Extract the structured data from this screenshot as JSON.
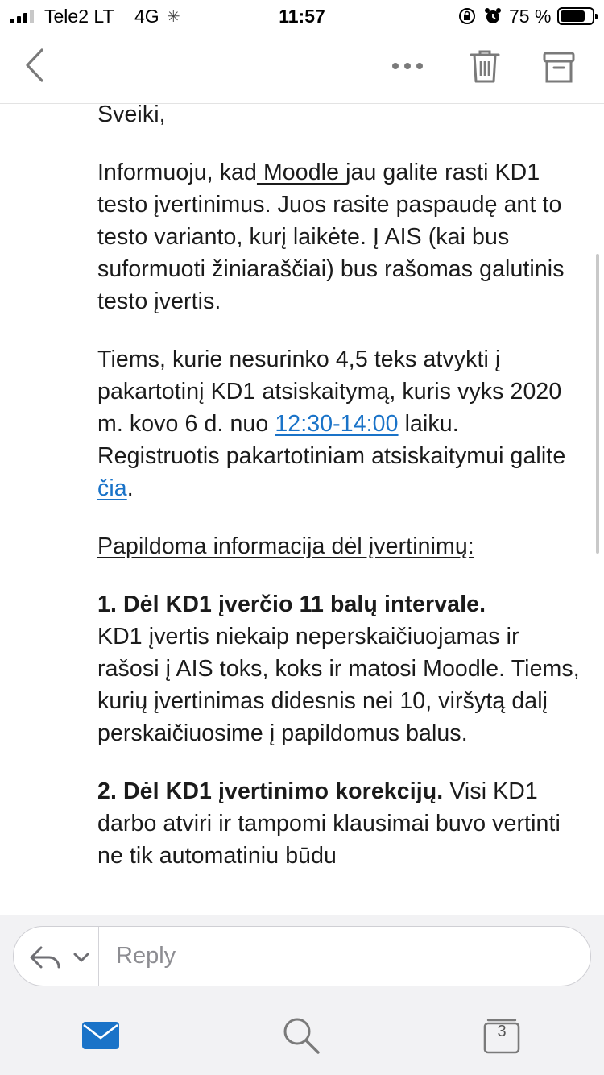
{
  "status_bar": {
    "carrier": "Tele2 LT",
    "network": "4G",
    "time": "11:57",
    "battery_percent": "75 %",
    "icons": [
      "signal-icon",
      "loading-icon",
      "orientation-lock-icon",
      "alarm-icon",
      "battery-icon"
    ]
  },
  "nav": {
    "icons": [
      "back-chevron-icon",
      "more-icon",
      "trash-icon",
      "archive-icon"
    ]
  },
  "email": {
    "greeting": "Sveiki,",
    "p1_before": "Informuoju, kad",
    "p1_link": " Moodle ",
    "p1_after": "jau galite rasti KD1 testo įvertinimus. Juos rasite paspaudę ant to testo varianto, kurį laikėte. Į AIS (kai bus suformuoti žiniaraščiai) bus rašomas galutinis testo įvertis.",
    "p2_before": "Tiems, kurie nesurinko 4,5 teks atvykti į pakartotinį KD1 atsiskaitymą, kuris vyks 2020 m. kovo 6 d. nuo",
    "p2_time_link": "12:30-14:00",
    "p2_mid": "laiku. Registruotis pakartotiniam atsiskaitymui galite",
    "p2_link": "čia",
    "p2_end": ".",
    "section_heading": "Papildoma informacija dėl įvertinimų:",
    "item1_title": "1. Dėl KD1 įverčio 11 balų intervale.",
    "item1_text": "KD1 įvertis niekaip neperskaičiuojamas ir rašosi į AIS toks, koks ir matosi Moodle. Tiems, kurių įvertinimas didesnis nei 10, viršytą dalį perskaičiuosime į papildomus balus.",
    "item2_title": "2. Dėl KD1 įvertinimo korekcijų.",
    "item2_text": "Visi KD1 darbo atviri ir tampomi klausimai buvo vertinti ne tik automatiniu būdu"
  },
  "reply": {
    "placeholder": "Reply",
    "icons": [
      "reply-arrow-icon",
      "chevron-down-icon"
    ]
  },
  "tabs": {
    "mail_icon": "mail-icon",
    "search_icon": "search-icon",
    "count_value": "3"
  },
  "colors": {
    "link": "#1a73c8",
    "accent_blue": "#1a73c8",
    "icon_gray": "#7a7a7a"
  }
}
